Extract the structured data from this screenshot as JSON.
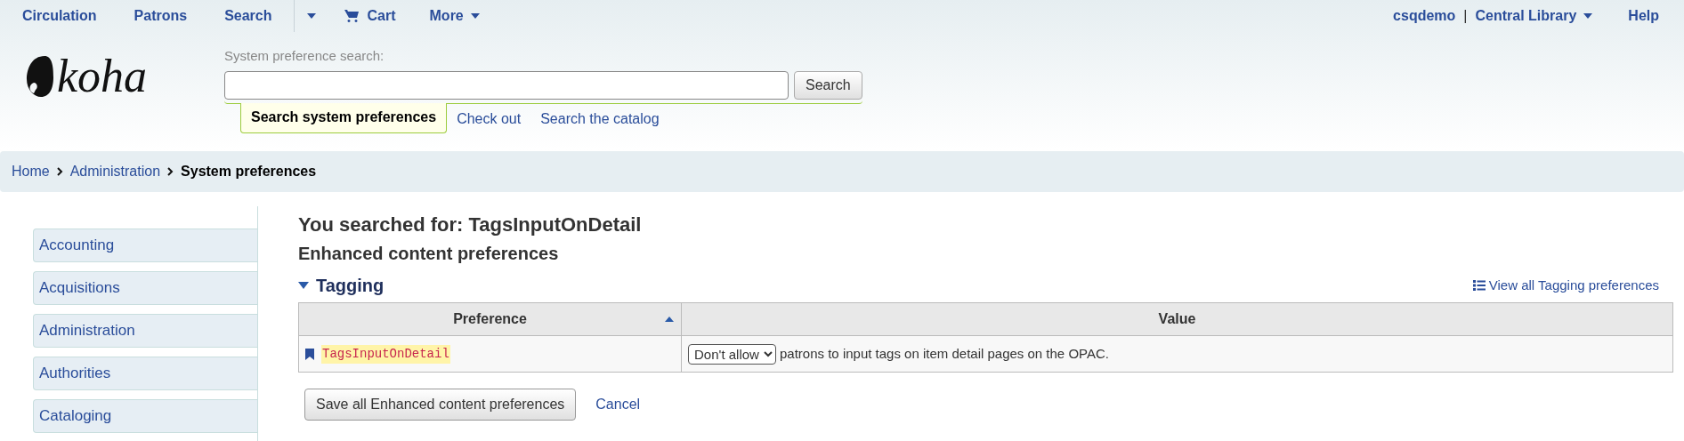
{
  "top_nav": {
    "items": [
      {
        "label": "Circulation",
        "kind": "link"
      },
      {
        "label": "Patrons",
        "kind": "link"
      },
      {
        "label": "Search",
        "kind": "link"
      },
      {
        "kind": "caret"
      },
      {
        "label": "Cart",
        "kind": "cart"
      },
      {
        "label": "More",
        "kind": "menu"
      }
    ],
    "user": "csqdemo",
    "separator": "|",
    "branch": "Central Library",
    "help": "Help"
  },
  "logo": "koha",
  "search": {
    "label": "System preference search:",
    "button": "Search",
    "tabs": [
      {
        "label": "Search system preferences",
        "selected": true
      },
      {
        "label": "Check out",
        "selected": false
      },
      {
        "label": "Search the catalog",
        "selected": false
      }
    ]
  },
  "breadcrumbs": [
    {
      "label": "Home",
      "current": false
    },
    {
      "label": "Administration",
      "current": false
    },
    {
      "label": "System preferences",
      "current": true
    }
  ],
  "sidebar": {
    "items": [
      "Accounting",
      "Acquisitions",
      "Administration",
      "Authorities",
      "Cataloging"
    ]
  },
  "main": {
    "title": "You searched for: TagsInputOnDetail",
    "subtitle": "Enhanced content preferences",
    "section": {
      "title": "Tagging",
      "expanded": true,
      "view_all": "View all Tagging preferences"
    },
    "table": {
      "columns": [
        {
          "label": "Preference",
          "sorted": true
        },
        {
          "label": "Value",
          "sorted": false
        }
      ],
      "rows": [
        {
          "preference": "TagsInputOnDetail",
          "select": "Don't allow",
          "text": "patrons to input tags on item detail pages on the OPAC."
        }
      ]
    },
    "save_button": "Save all Enhanced content preferences",
    "cancel": "Cancel"
  }
}
